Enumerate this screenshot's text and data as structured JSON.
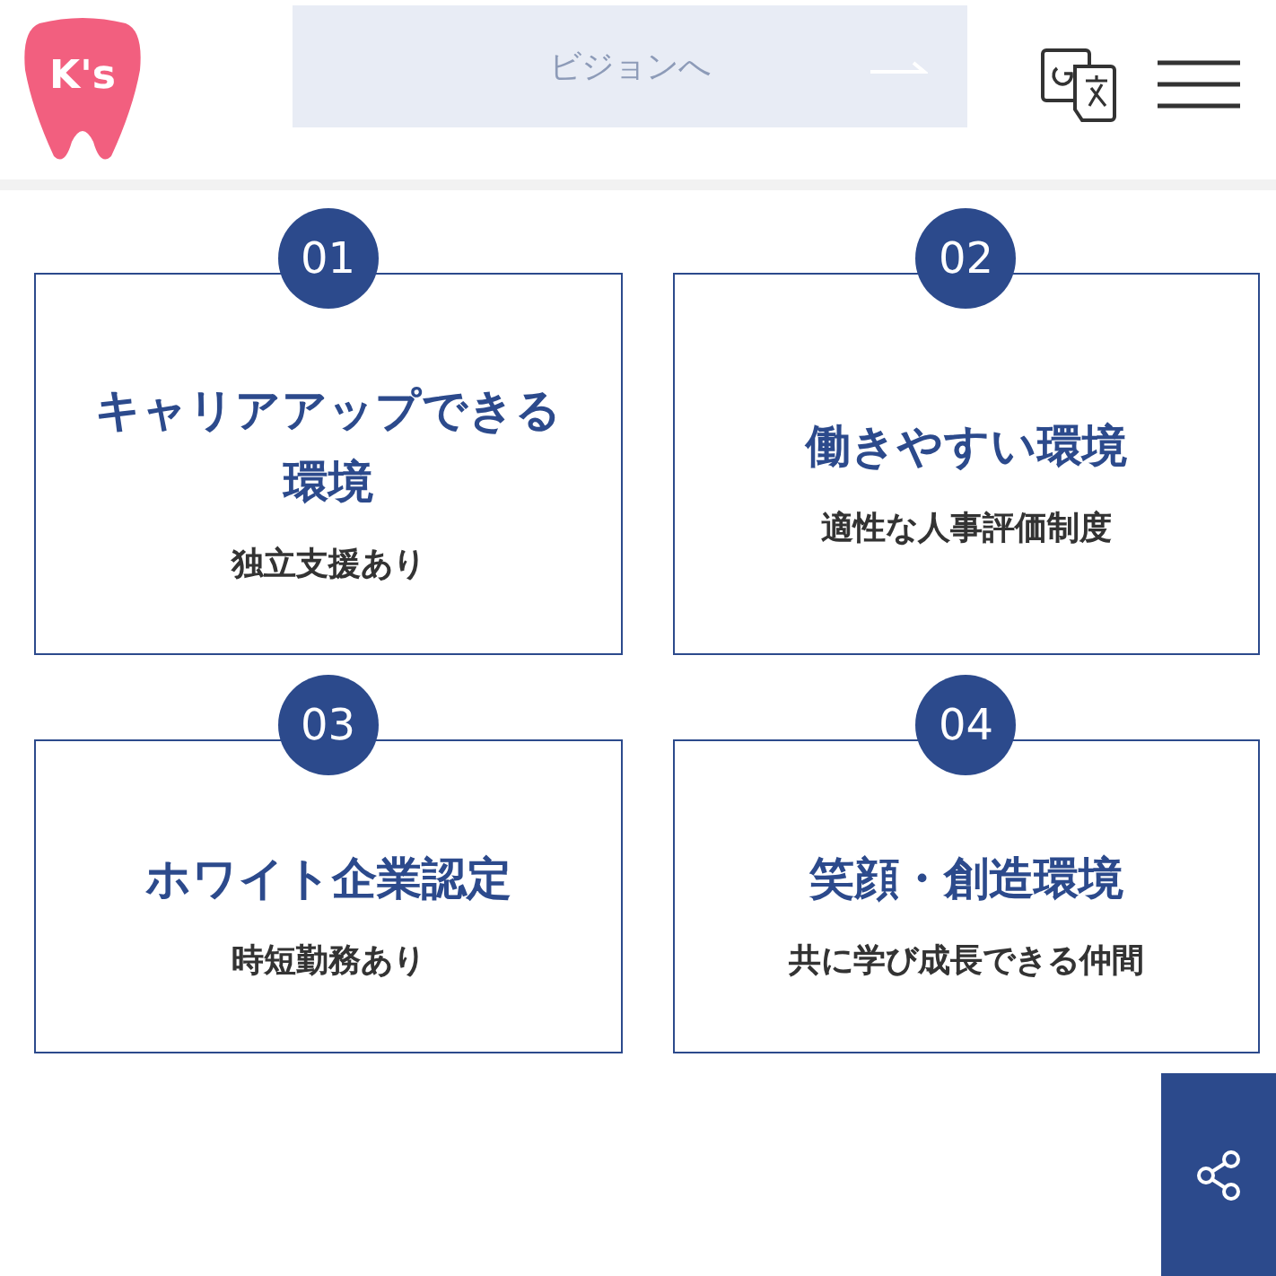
{
  "header": {
    "logo_text": "K's",
    "vision_button": {
      "label": "ビジョンへ"
    }
  },
  "features": [
    {
      "number": "01",
      "title": "キャリアアップできる環境",
      "subtitle": "独立支援あり"
    },
    {
      "number": "02",
      "title": "働きやすい環境",
      "subtitle": "適性な人事評価制度"
    },
    {
      "number": "03",
      "title": "ホワイト企業認定",
      "subtitle": "時短勤務あり"
    },
    {
      "number": "04",
      "title": "笑顔・創造環境",
      "subtitle": "共に学び成長できる仲間"
    }
  ]
}
